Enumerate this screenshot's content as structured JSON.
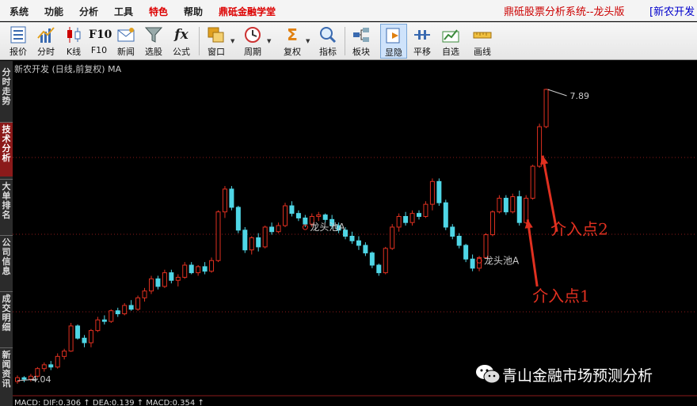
{
  "menu": {
    "items": [
      {
        "label": "系统",
        "color": "#222222"
      },
      {
        "label": "功能",
        "color": "#222222"
      },
      {
        "label": "分析",
        "color": "#222222"
      },
      {
        "label": "工具",
        "color": "#222222"
      },
      {
        "label": "特色",
        "color": "#dd0000"
      },
      {
        "label": "帮助",
        "color": "#222222"
      },
      {
        "label": "鼎砥金融学堂",
        "color": "#dd0000"
      }
    ],
    "app_title": "鼎砥股票分析系统--龙头版",
    "stock_tab": "[新农开发"
  },
  "toolbar": {
    "buttons": [
      {
        "label": "报价",
        "icon": "quote-list-icon"
      },
      {
        "label": "分时",
        "icon": "intraday-chart-icon"
      },
      {
        "label": "K线",
        "icon": "candlestick-icon"
      },
      {
        "label": "F10",
        "icon": "f10-text-icon"
      },
      {
        "label": "新闻",
        "icon": "news-mail-icon"
      },
      {
        "label": "选股",
        "icon": "funnel-icon"
      },
      {
        "label": "公式",
        "icon": "fx-formula-icon"
      },
      {
        "label": "窗口",
        "icon": "windows-icon"
      },
      {
        "label": "周期",
        "icon": "clock-icon"
      },
      {
        "label": "复权",
        "icon": "sigma-icon"
      },
      {
        "label": "指标",
        "icon": "magnifier-icon"
      },
      {
        "label": "板块",
        "icon": "sector-icon"
      },
      {
        "label": "显隐",
        "icon": "show-hide-icon"
      },
      {
        "label": "平移",
        "icon": "pan-icon"
      },
      {
        "label": "自选",
        "icon": "watchlist-icon"
      },
      {
        "label": "画线",
        "icon": "ruler-icon"
      }
    ],
    "f10_glyph": "F10",
    "fx_glyph": "fx",
    "sigma_glyph": "Σ"
  },
  "sidebar": {
    "tabs": [
      {
        "label": "分时走势",
        "active": false
      },
      {
        "label": "技术分析",
        "active": true
      },
      {
        "label": "大单排名",
        "active": false
      },
      {
        "label": "公司信息",
        "active": false
      },
      {
        "label": "成交明细",
        "active": false
      },
      {
        "label": "新闻资讯",
        "active": false
      }
    ]
  },
  "chart_header": "新农开发 (日线,前复权) MA",
  "macd_text": "MACD: DIF:0.306 ↑ DEA:0.139 ↑ MACD:0.354 ↑",
  "watermark": "青山金融市场预测分析",
  "chart_data": {
    "type": "candlestick",
    "high_label": "7.89",
    "low_label": "4.04",
    "annotations": [
      {
        "text": "龙头池A",
        "color": "#cccccc"
      },
      {
        "text": "龙头池A",
        "color": "#cccccc"
      },
      {
        "text": "介入点1",
        "color": "#e03020"
      },
      {
        "text": "介入点2",
        "color": "#e03020"
      }
    ],
    "up_color": "#e03020",
    "down_color": "#4fd6e6",
    "candles": [
      [
        4.05,
        4.13,
        4.02,
        4.1
      ],
      [
        4.1,
        4.12,
        4.04,
        4.08
      ],
      [
        4.08,
        4.15,
        4.05,
        4.12
      ],
      [
        4.12,
        4.24,
        4.1,
        4.22
      ],
      [
        4.22,
        4.3,
        4.18,
        4.27
      ],
      [
        4.27,
        4.32,
        4.2,
        4.24
      ],
      [
        4.24,
        4.42,
        4.22,
        4.38
      ],
      [
        4.38,
        4.48,
        4.34,
        4.45
      ],
      [
        4.45,
        4.82,
        4.44,
        4.78
      ],
      [
        4.78,
        4.8,
        4.6,
        4.62
      ],
      [
        4.62,
        4.66,
        4.5,
        4.56
      ],
      [
        4.56,
        4.74,
        4.5,
        4.72
      ],
      [
        4.72,
        4.9,
        4.7,
        4.86
      ],
      [
        4.86,
        4.92,
        4.8,
        4.84
      ],
      [
        4.84,
        5.0,
        4.82,
        4.98
      ],
      [
        4.98,
        5.02,
        4.9,
        4.94
      ],
      [
        4.94,
        5.08,
        4.92,
        5.05
      ],
      [
        5.05,
        5.12,
        4.98,
        5.0
      ],
      [
        5.0,
        5.18,
        4.98,
        5.15
      ],
      [
        5.15,
        5.28,
        5.1,
        5.24
      ],
      [
        5.24,
        5.44,
        5.2,
        5.4
      ],
      [
        5.4,
        5.44,
        5.26,
        5.3
      ],
      [
        5.3,
        5.52,
        5.28,
        5.48
      ],
      [
        5.48,
        5.52,
        5.34,
        5.38
      ],
      [
        5.38,
        5.46,
        5.3,
        5.42
      ],
      [
        5.42,
        5.62,
        5.4,
        5.58
      ],
      [
        5.58,
        5.62,
        5.46,
        5.48
      ],
      [
        5.48,
        5.58,
        5.44,
        5.56
      ],
      [
        5.56,
        5.62,
        5.46,
        5.5
      ],
      [
        5.5,
        5.68,
        5.48,
        5.64
      ],
      [
        5.64,
        6.3,
        5.62,
        6.28
      ],
      [
        6.28,
        6.62,
        6.2,
        6.58
      ],
      [
        6.58,
        6.62,
        6.3,
        6.34
      ],
      [
        6.34,
        6.36,
        6.0,
        6.04
      ],
      [
        6.04,
        6.08,
        5.74,
        5.78
      ],
      [
        5.78,
        5.96,
        5.72,
        5.94
      ],
      [
        5.94,
        6.0,
        5.76,
        5.82
      ],
      [
        5.82,
        6.1,
        5.8,
        6.08
      ],
      [
        6.08,
        6.14,
        5.98,
        6.02
      ],
      [
        6.02,
        6.14,
        6.0,
        6.1
      ],
      [
        6.1,
        6.4,
        6.08,
        6.36
      ],
      [
        6.36,
        6.42,
        6.22,
        6.26
      ],
      [
        6.26,
        6.3,
        6.16,
        6.2
      ],
      [
        6.2,
        6.24,
        6.08,
        6.12
      ],
      [
        6.12,
        6.26,
        6.08,
        6.22
      ],
      [
        6.22,
        6.28,
        6.16,
        6.24
      ],
      [
        6.24,
        6.26,
        6.14,
        6.18
      ],
      [
        6.18,
        6.24,
        6.06,
        6.1
      ],
      [
        6.1,
        6.14,
        6.0,
        6.04
      ],
      [
        6.04,
        6.08,
        5.92,
        5.96
      ],
      [
        5.96,
        6.02,
        5.86,
        5.9
      ],
      [
        5.9,
        5.96,
        5.78,
        5.84
      ],
      [
        5.84,
        5.88,
        5.7,
        5.74
      ],
      [
        5.74,
        5.76,
        5.54,
        5.58
      ],
      [
        5.58,
        5.6,
        5.44,
        5.48
      ],
      [
        5.48,
        5.82,
        5.46,
        5.8
      ],
      [
        5.8,
        6.12,
        5.78,
        6.08
      ],
      [
        6.08,
        6.26,
        6.02,
        6.22
      ],
      [
        6.22,
        6.28,
        6.1,
        6.14
      ],
      [
        6.14,
        6.3,
        6.1,
        6.26
      ],
      [
        6.26,
        6.3,
        6.18,
        6.22
      ],
      [
        6.22,
        6.42,
        6.2,
        6.38
      ],
      [
        6.38,
        6.72,
        6.3,
        6.68
      ],
      [
        6.68,
        6.72,
        6.36,
        6.4
      ],
      [
        6.4,
        6.44,
        6.04,
        6.08
      ],
      [
        6.08,
        6.12,
        5.92,
        5.96
      ],
      [
        5.96,
        6.0,
        5.8,
        5.84
      ],
      [
        5.84,
        5.86,
        5.62,
        5.66
      ],
      [
        5.66,
        5.72,
        5.5,
        5.54
      ],
      [
        5.54,
        5.7,
        5.5,
        5.68
      ],
      [
        5.68,
        6.0,
        5.66,
        5.98
      ],
      [
        5.98,
        6.3,
        5.96,
        6.28
      ],
      [
        6.28,
        6.5,
        6.26,
        6.46
      ],
      [
        6.46,
        6.5,
        6.24,
        6.28
      ],
      [
        6.28,
        6.52,
        6.26,
        6.48
      ],
      [
        6.48,
        6.56,
        6.1,
        6.14
      ],
      [
        6.14,
        6.5,
        6.12,
        6.46
      ],
      [
        6.46,
        6.9,
        6.44,
        6.88
      ],
      [
        6.88,
        7.44,
        6.86,
        7.4
      ],
      [
        7.4,
        7.9,
        7.38,
        7.89
      ]
    ]
  }
}
